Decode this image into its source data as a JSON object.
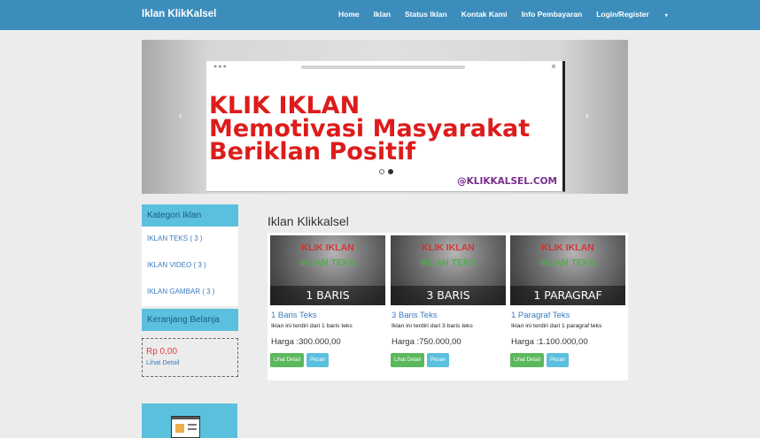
{
  "navbar": {
    "brand": "Iklan KlikKalsel",
    "items": [
      "Home",
      "Iklan",
      "Status Iklan",
      "Kontak Kami",
      "Info Pembayaran",
      "Login/Register"
    ]
  },
  "carousel": {
    "slide_lines": [
      "KLIK IKLAN",
      "Memotivasi Masyarakat",
      "Beriklan Positif"
    ],
    "handle": "@KLIKKALSEL.COM",
    "prev": "‹",
    "next": "›"
  },
  "sidebar": {
    "categories_title": "Kategori Iklan",
    "categories": [
      "IKLAN TEKS ( 3 )",
      "IKLAN VIDEO ( 3 )",
      "IKLAN GAMBAR ( 3 )"
    ],
    "cart_title": "Keranjang Belanja",
    "cart_amount": "Rp 0,00",
    "cart_link": "Lihat Detail"
  },
  "main": {
    "title": "Iklan Klikkalsel",
    "products": [
      {
        "img_top": "KLIK IKLAN",
        "img_sub": "IKLAN TEKS",
        "img_strip": "1 BARIS",
        "title": "1 Baris Teks",
        "desc": "Iklan ini terdiri dari 1 baris teks",
        "price": "Harga :300.000,00",
        "btn_detail": "Lihat Detail",
        "btn_order": "Pesan"
      },
      {
        "img_top": "KLIK IKLAN",
        "img_sub": "IKLAN TEKS",
        "img_strip": "3 BARIS",
        "title": "3 Baris Teks",
        "desc": "Iklan ini terdiri dari 3 baris teks",
        "price": "Harga :750.000,00",
        "btn_detail": "Lihat Detail",
        "btn_order": "Pesan"
      },
      {
        "img_top": "KLIK IKLAN",
        "img_sub": "IKLAN TEKS",
        "img_strip": "1 PARAGRAF",
        "title": "1 Paragraf Teks",
        "desc": "Iklan ini terdiri dari 1 paragraf teks",
        "price": "Harga :1.100.000,00",
        "btn_detail": "Lihat Detail",
        "btn_order": "Pesan"
      }
    ]
  }
}
